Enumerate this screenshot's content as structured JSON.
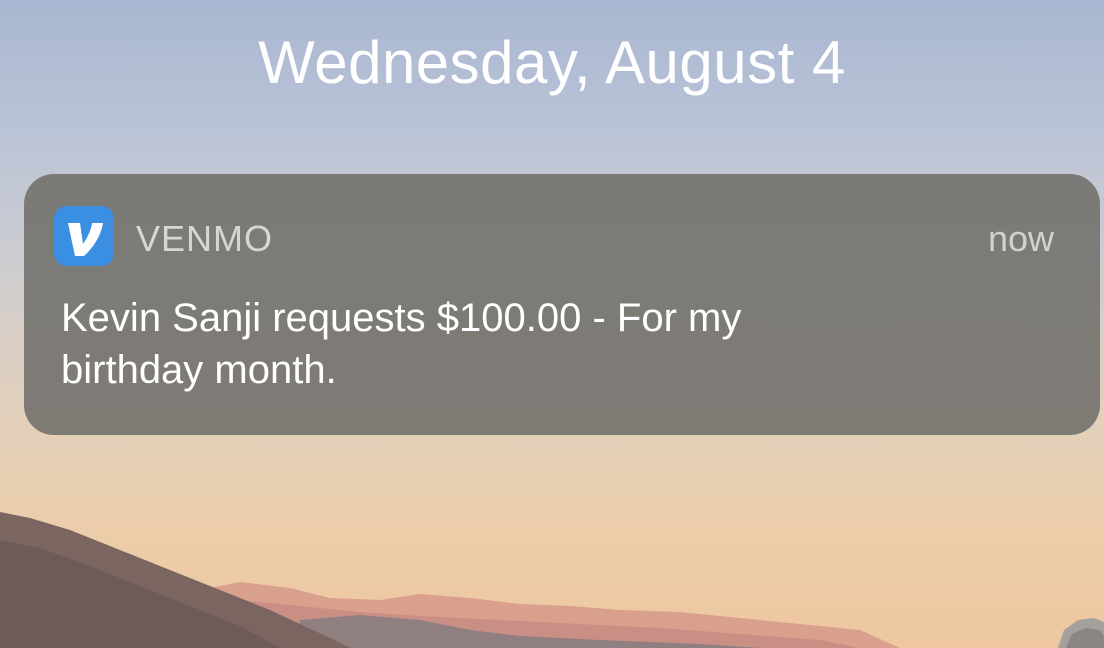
{
  "lock_screen": {
    "date": "Wednesday, August 4"
  },
  "notification": {
    "app_name": "VENMO",
    "app_icon": "venmo-v-icon",
    "app_icon_color": "#3b8fe3",
    "time": "now",
    "message": "Kevin Sanji requests $100.00 - For my birthday month."
  }
}
